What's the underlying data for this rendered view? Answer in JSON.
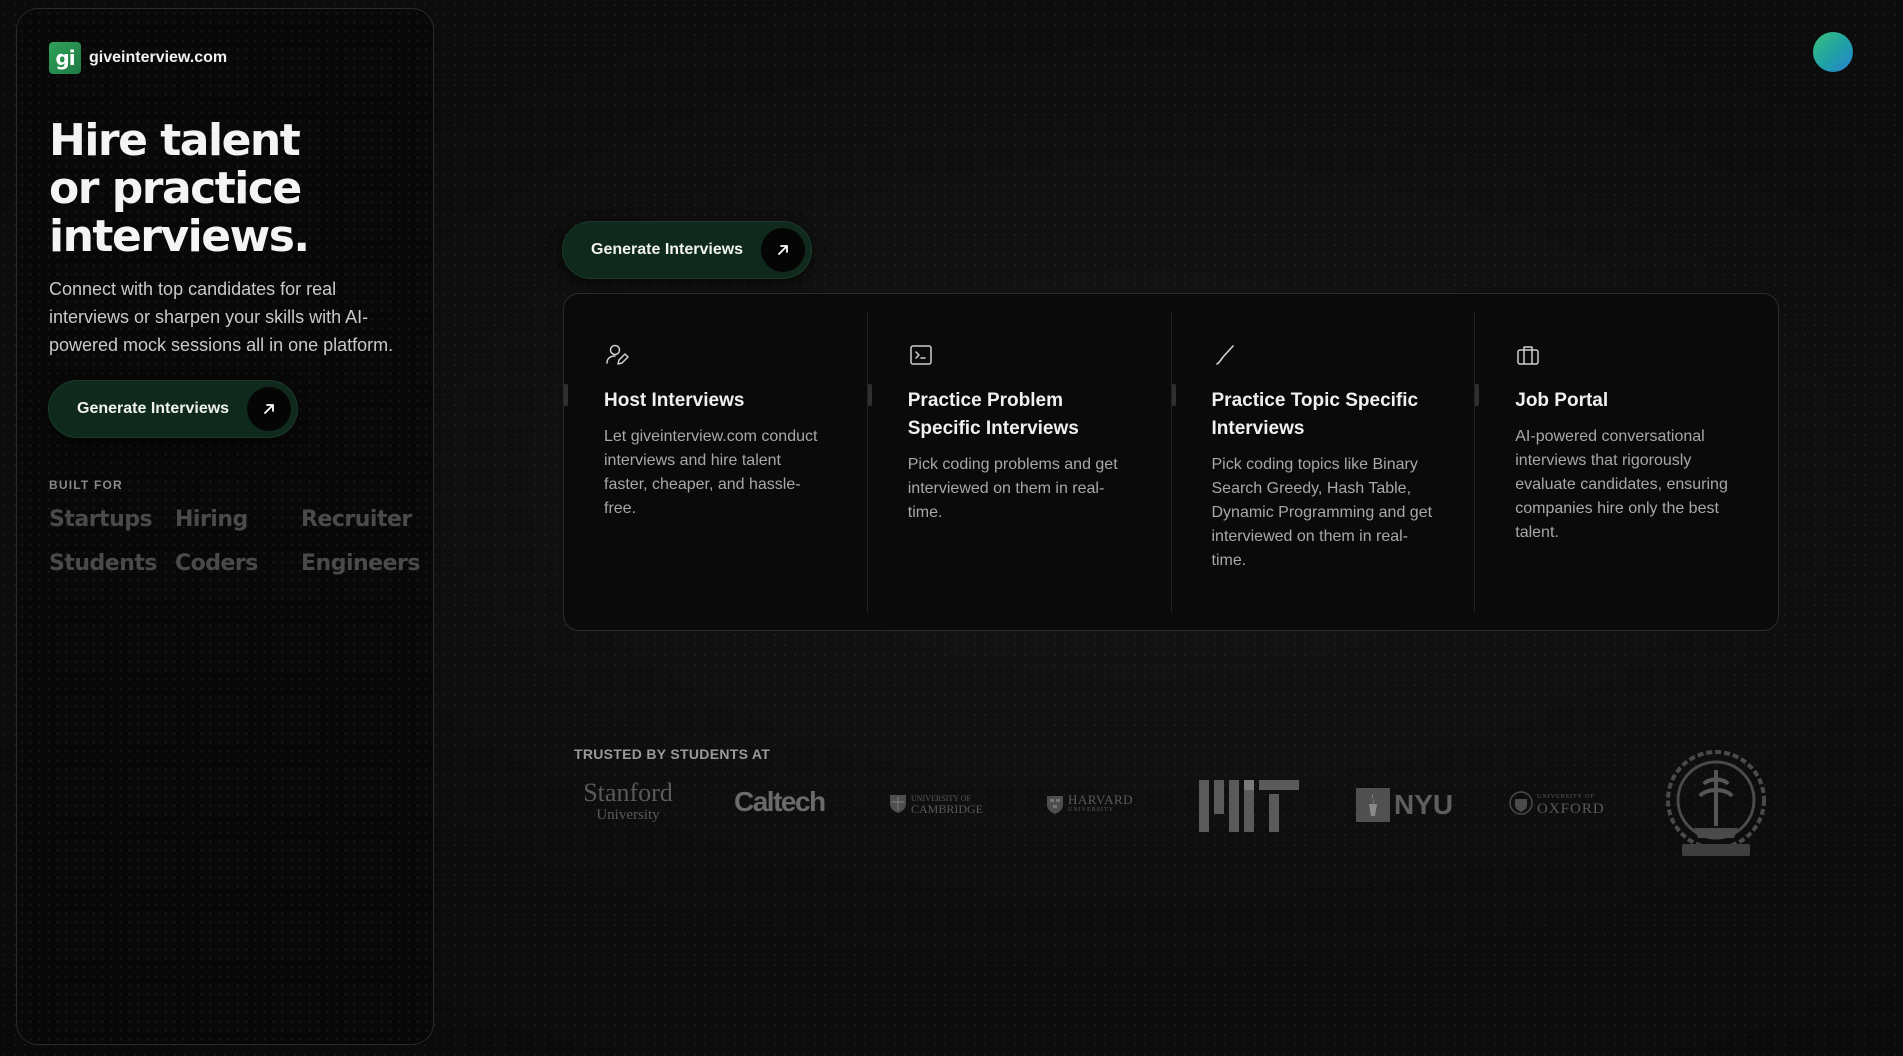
{
  "brand": {
    "logo_text": "gi",
    "name": "giveinterview.com"
  },
  "hero": {
    "title_lines": [
      "Hire talent",
      "or practice",
      "interviews."
    ],
    "subtitle": "Connect with top candidates for real interviews or sharpen your skills with AI-powered mock sessions all in one platform.",
    "cta_label": "Generate Interviews"
  },
  "built_for": {
    "label": "BUILT FOR",
    "items": [
      "Startups",
      "Hiring",
      "Recruiter",
      "Students",
      "Coders",
      "Engineers"
    ]
  },
  "main": {
    "cta_label": "Generate Interviews",
    "features": [
      {
        "icon": "user-edit-icon",
        "title": "Host Interviews",
        "desc": "Let giveinterview.com conduct interviews and hire talent faster, cheaper, and hassle-free."
      },
      {
        "icon": "terminal-icon",
        "title": "Practice Problem Specific Interviews",
        "desc": "Pick coding problems and get interviewed on them in real-time."
      },
      {
        "icon": "brush-stroke-icon",
        "title": "Practice Topic Specific Interviews",
        "desc": "Pick coding topics like Binary Search Greedy, Hash Table, Dynamic Programming and get interviewed on them in real-time."
      },
      {
        "icon": "briefcase-icon",
        "title": "Job Portal",
        "desc": "AI-powered conversational interviews that rigorously evaluate candidates, ensuring companies hire only the best talent."
      }
    ]
  },
  "trusted": {
    "label": "TRUSTED BY STUDENTS AT",
    "logos": {
      "stanford": [
        "Stanford",
        "University"
      ],
      "caltech": "Caltech",
      "cambridge": [
        "UNIVERSITY OF",
        "CAMBRIDGE"
      ],
      "harvard": [
        "HARVARD",
        "UNIVERSITY"
      ],
      "nyu": "NYU",
      "oxford": [
        "UNIVERSITY OF",
        "OXFORD"
      ]
    }
  },
  "colors": {
    "background": "#0c0c0c",
    "button_bg": "#0f2a1d",
    "muted_text": "#4a4a4a",
    "avatar_gradient": [
      "#3ac07a",
      "#2a7fd0"
    ]
  }
}
